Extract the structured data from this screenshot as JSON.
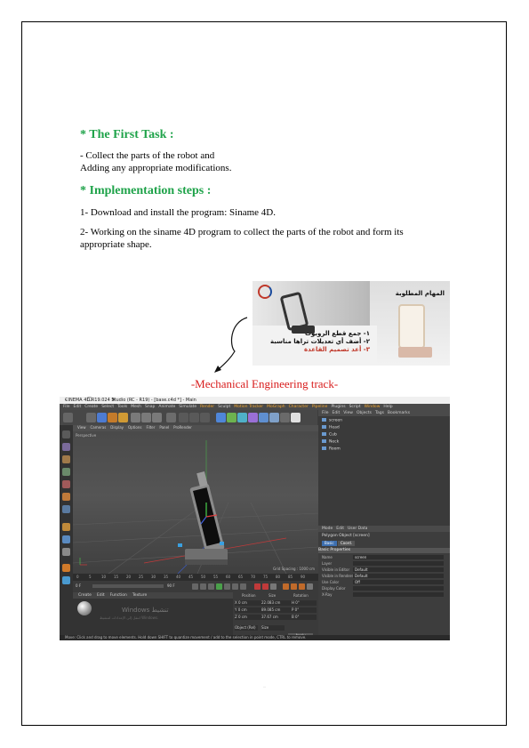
{
  "task": {
    "heading": "*  The First Task :",
    "line1": "- Collect the parts of the robot and",
    "line2": "Adding any appropriate modifications."
  },
  "steps": {
    "heading": "*  Implementation steps :",
    "step1": " 1- Download and install the program: Siname 4D.",
    "step2": " 2- Working on the siname 4D program to collect the parts of the robot and form its appropriate shape."
  },
  "slide": {
    "title": "المهام المطلوبة",
    "item1": "١- جمع قطع الروبوت",
    "item2": "٢- أضف أي تعديلات تراها مناسبة",
    "item3": "٣- أعد تصميم القاعدة"
  },
  "track_label": "-Mechanical Engineering track-",
  "colors": {
    "heading_green": "#1fa34a",
    "track_red": "#d81b1b",
    "slide_red": "#c0392b"
  },
  "c4d": {
    "window_title": "CINEMA 4D R19.024 Studio (RC - R19) - [base.c4d *] - Main",
    "window_controls": "–  ☐  ✕",
    "menu": [
      "File",
      "Edit",
      "Create",
      "Select",
      "Tools",
      "Mesh",
      "Snap",
      "Animate",
      "Simulate",
      "Render",
      "Sculpt",
      "Motion Tracker",
      "MoGraph",
      "Character",
      "Pipeline",
      "Plugins",
      "Script",
      "Window",
      "Help"
    ],
    "menu_highlight": [
      "Render",
      "Motion Tracker",
      "MoGraph",
      "Character",
      "Pipeline",
      "Window"
    ],
    "viewport_menu": [
      "View",
      "Cameras",
      "Display",
      "Options",
      "Filter",
      "Panel",
      "ProRender"
    ],
    "viewport_label": "Perspective",
    "grid_spacing": "Grid Spacing : 1000 cm",
    "timeline_ticks": [
      "0",
      "5",
      "10",
      "15",
      "20",
      "25",
      "30",
      "35",
      "40",
      "45",
      "50",
      "55",
      "60",
      "65",
      "70",
      "75",
      "80",
      "85",
      "90"
    ],
    "frame_start": "0 F",
    "frame_end": "90 F",
    "objects_menu": [
      "File",
      "Edit",
      "View",
      "Objects",
      "Tags",
      "Bookmarks"
    ],
    "objects": [
      "screen",
      "Head",
      "Cub",
      "Neck",
      "Room"
    ],
    "material_tabs": [
      "Create",
      "Edit",
      "Function",
      "Texture"
    ],
    "watermark_line1": "Windows تنشيط",
    "watermark_line2": "انتقل إلى الإعدادات لتنشيط Windows.",
    "coord_headers": [
      "Position",
      "Size",
      "Rotation"
    ],
    "coord_rows": [
      {
        "axis": "X",
        "pos": "0 cm",
        "size": "22.083 cm",
        "rot": "H 0°"
      },
      {
        "axis": "Y",
        "pos": "0 cm",
        "size": "89.085 cm",
        "rot": "P 0°"
      },
      {
        "axis": "Z",
        "pos": "0 cm",
        "size": "37.67 cm",
        "rot": "B 0°"
      }
    ],
    "coord_mode": "Object (Rel)",
    "coord_size": "Size",
    "apply_label": "Apply",
    "attr_menu": [
      "Mode",
      "Edit",
      "User Data"
    ],
    "attr_title": "Polygon Object [screen]",
    "attr_tabs": [
      "Basic",
      "Coord."
    ],
    "attr_section": "Basic Properties",
    "attr_props": [
      {
        "label": "Name",
        "value": "screen"
      },
      {
        "label": "Layer",
        "value": ""
      },
      {
        "label": "Visible in Editor",
        "value": "Default"
      },
      {
        "label": "Visible in Renderer",
        "value": "Default"
      },
      {
        "label": "Use Color",
        "value": "Off"
      },
      {
        "label": "Display Color",
        "value": ""
      },
      {
        "label": "X-Ray",
        "value": ""
      }
    ],
    "status": "Move: Click and drag to move elements. Hold down SHIFT to quantize movement / add to the selection in point mode, CTRL to remove."
  }
}
